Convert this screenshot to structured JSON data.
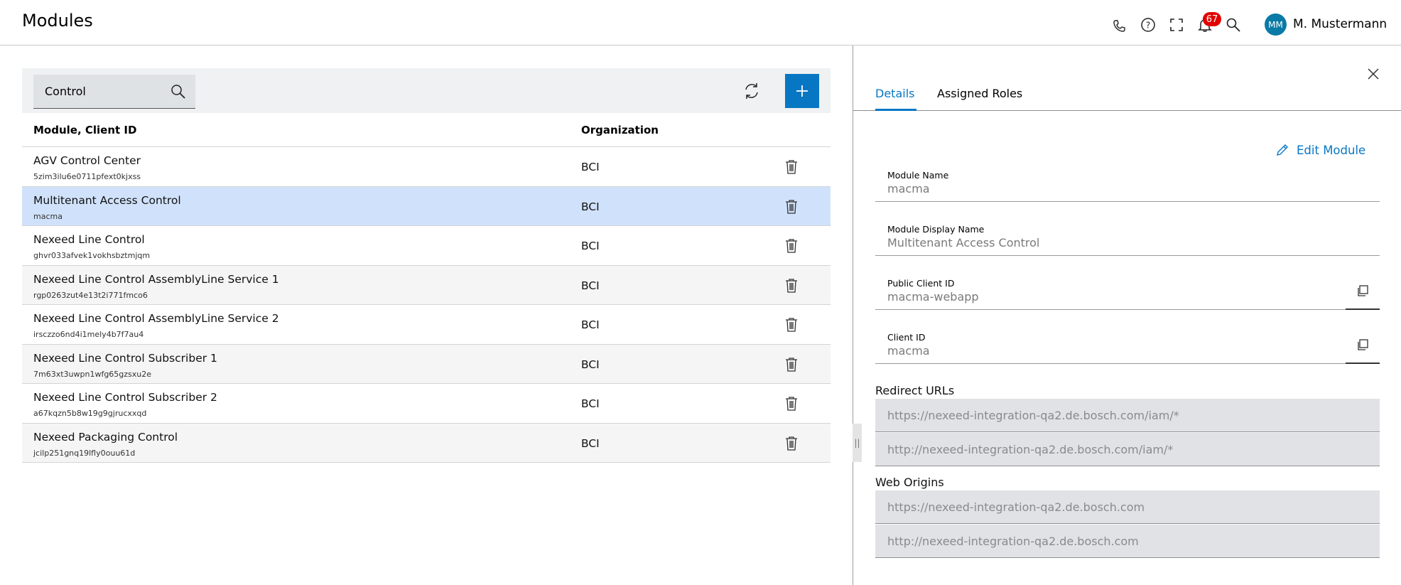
{
  "header": {
    "title": "Modules",
    "notification_count": "67",
    "user_initials": "MM",
    "user_name": "M. Mustermann",
    "icons": [
      "phone-icon",
      "help-icon",
      "fullscreen-icon",
      "bell-icon",
      "search-icon"
    ]
  },
  "toolbar": {
    "search_value": "Control"
  },
  "table": {
    "columns": [
      "Module, Client ID",
      "Organization"
    ],
    "rows": [
      {
        "name": "AGV Control Center",
        "client_id": "5zim3ilu6e0711pfext0kjxss",
        "organization": "BCI"
      },
      {
        "name": "Multitenant Access Control",
        "client_id": "macma",
        "organization": "BCI"
      },
      {
        "name": "Nexeed Line Control",
        "client_id": "ghvr033afvek1vokhsbztmjqm",
        "organization": "BCI"
      },
      {
        "name": "Nexeed Line Control AssemblyLine Service 1",
        "client_id": "rgp0263zut4e13t2i771fmco6",
        "organization": "BCI"
      },
      {
        "name": "Nexeed Line Control AssemblyLine Service 2",
        "client_id": "irsczzo6nd4i1mely4b7f7au4",
        "organization": "BCI"
      },
      {
        "name": "Nexeed Line Control Subscriber 1",
        "client_id": "7m63xt3uwpn1wfg65gzsxu2e",
        "organization": "BCI"
      },
      {
        "name": "Nexeed Line Control Subscriber 2",
        "client_id": "a67kqzn5b8w19g9gjrucxxqd",
        "organization": "BCI"
      },
      {
        "name": "Nexeed Packaging Control",
        "client_id": "jcilp251gnq19lfly0ouu61d",
        "organization": "BCI"
      }
    ]
  },
  "detail": {
    "tabs": [
      "Details",
      "Assigned Roles"
    ],
    "edit_label": "Edit Module",
    "fields": {
      "module_name": {
        "label": "Module Name",
        "value": "macma"
      },
      "display_name": {
        "label": "Module Display Name",
        "value": "Multitenant Access Control"
      },
      "public_client_id": {
        "label": "Public Client ID",
        "value": "macma-webapp"
      },
      "client_id": {
        "label": "Client ID",
        "value": "macma"
      }
    },
    "redirect_title": "Redirect URLs",
    "redirect_urls": [
      "https://nexeed-integration-qa2.de.bosch.com/iam/*",
      "http://nexeed-integration-qa2.de.bosch.com/iam/*"
    ],
    "origins_title": "Web Origins",
    "web_origins": [
      "https://nexeed-integration-qa2.de.bosch.com",
      "http://nexeed-integration-qa2.de.bosch.com"
    ]
  },
  "colors": {
    "accent": "#0777c3",
    "selected_row": "#d0e2fb",
    "badge": "#e00000",
    "avatar": "#0a7aa6"
  }
}
